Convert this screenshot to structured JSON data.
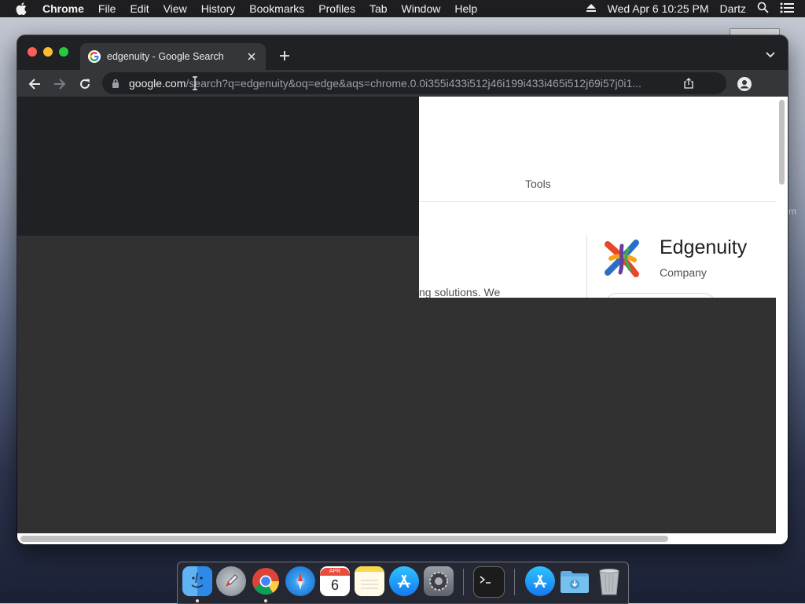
{
  "menubar": {
    "app_name": "Chrome",
    "items": [
      "File",
      "Edit",
      "View",
      "History",
      "Bookmarks",
      "Profiles",
      "Tab",
      "Window",
      "Help"
    ],
    "datetime": "Wed Apr 6  10:25 PM",
    "user": "Dartz"
  },
  "browser": {
    "tab_title": "edgenuity - Google Search",
    "url_host": "google.com",
    "url_path": "/search?q=edgenuity&oq=edge&aqs=chrome.0.0i355i433i512j46i199i433i465i512j69i57j0i1..."
  },
  "page": {
    "tools_label": "Tools",
    "snippet_fragment": "ng solutions. We",
    "knowledge_panel": {
      "title": "Edgenuity",
      "subtitle": "Company"
    }
  },
  "desktop": {
    "partial_label": "m"
  },
  "dock": {
    "calendar_month": "APR",
    "calendar_day": "6",
    "apps": [
      "finder-icon",
      "launchpad-icon",
      "chrome-icon",
      "safari-icon",
      "calendar-icon",
      "notes-icon",
      "app-store-icon",
      "system-preferences-icon",
      "terminal-icon",
      "applications-folder-icon",
      "downloads-folder-icon",
      "trash-icon"
    ]
  },
  "colors": {
    "menubar_bg": "#1e1e20",
    "tab_active_bg": "#35363a",
    "window_bg": "#202124",
    "viewport_dark": "#313131"
  }
}
